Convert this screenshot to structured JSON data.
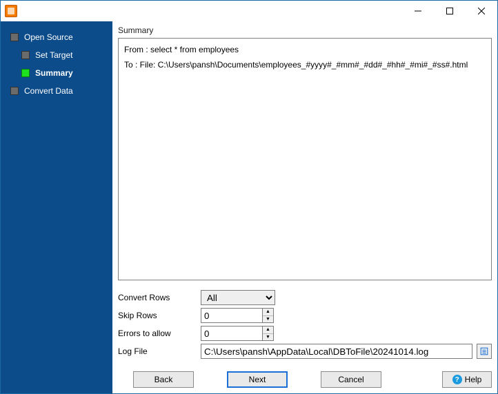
{
  "titlebar": {
    "title": ""
  },
  "sidebar": {
    "items": [
      {
        "label": "Open Source"
      },
      {
        "label": "Set Target"
      },
      {
        "label": "Summary"
      },
      {
        "label": "Convert Data"
      }
    ]
  },
  "main": {
    "panel_title": "Summary",
    "summary": {
      "from_line": "From : select * from employees",
      "to_line": "To : File: C:\\Users\\pansh\\Documents\\employees_#yyyy#_#mm#_#dd#_#hh#_#mi#_#ss#.html"
    },
    "form": {
      "convert_rows": {
        "label": "Convert Rows",
        "value": "All"
      },
      "skip_rows": {
        "label": "Skip Rows",
        "value": "0"
      },
      "errors_allow": {
        "label": "Errors to allow",
        "value": "0"
      },
      "log_file": {
        "label": "Log File",
        "value": "C:\\Users\\pansh\\AppData\\Local\\DBToFile\\20241014.log"
      }
    }
  },
  "footer": {
    "back": "Back",
    "next": "Next",
    "cancel": "Cancel",
    "help": "Help"
  }
}
